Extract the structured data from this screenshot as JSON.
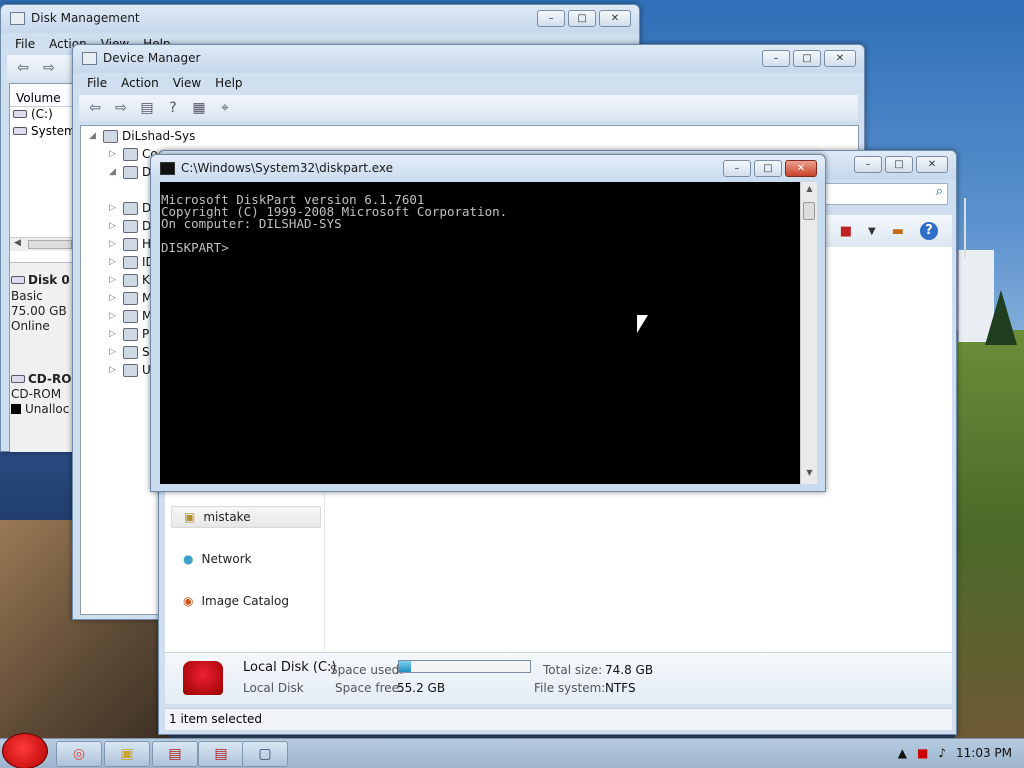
{
  "disk_management": {
    "title": "Disk Management",
    "menu": [
      "File",
      "Action",
      "View",
      "Help"
    ],
    "column": "Volume",
    "volumes": [
      "(C:)",
      "System"
    ],
    "disk0": {
      "name": "Disk 0",
      "type": "Basic",
      "size": "75.00 GB",
      "status": "Online"
    },
    "cdrom": {
      "name": "CD-ROM",
      "label": "CD-ROM",
      "legend": "Unalloc"
    }
  },
  "device_manager": {
    "title": "Device Manager",
    "menu": [
      "File",
      "Action",
      "View",
      "Help"
    ],
    "root": "DiLshad-Sys",
    "partial_items": [
      "Co",
      "D",
      "D",
      "D",
      "H",
      "ID",
      "K",
      "M",
      "M",
      "P",
      "S",
      "U"
    ]
  },
  "explorer": {
    "nav": [
      {
        "label": "mistake",
        "icon": "folder-icon"
      },
      {
        "label": "Network",
        "icon": "network-icon"
      },
      {
        "label": "Image Catalog",
        "icon": "image-catalog-icon"
      }
    ],
    "details": {
      "name": "Local Disk (C:)",
      "type": "Local Disk",
      "space_used_label": "Space used:",
      "space_used_fraction": 0.09,
      "space_free_label": "Space free:",
      "space_free": "55.2 GB",
      "total_size_label": "Total size:",
      "total_size": "74.8 GB",
      "fs_label": "File system:",
      "fs": "NTFS"
    },
    "status": "1 item selected"
  },
  "cmd": {
    "title": "C:\\Windows\\System32\\diskpart.exe",
    "lines": [
      "Microsoft DiskPart version 6.1.7601",
      "Copyright (C) 1999-2008 Microsoft Corporation.",
      "On computer: DILSHAD-SYS",
      "",
      "DISKPART> "
    ]
  },
  "taskbar": {
    "clock": "11:03 PM",
    "items": [
      "chrome-icon",
      "folder-icon",
      "toolbox-icon",
      "toolbox-icon",
      "window-icon"
    ]
  },
  "colors": {
    "console_bg": "#000000",
    "console_fg": "#c0c0c0",
    "progress": "#29a3d6"
  }
}
